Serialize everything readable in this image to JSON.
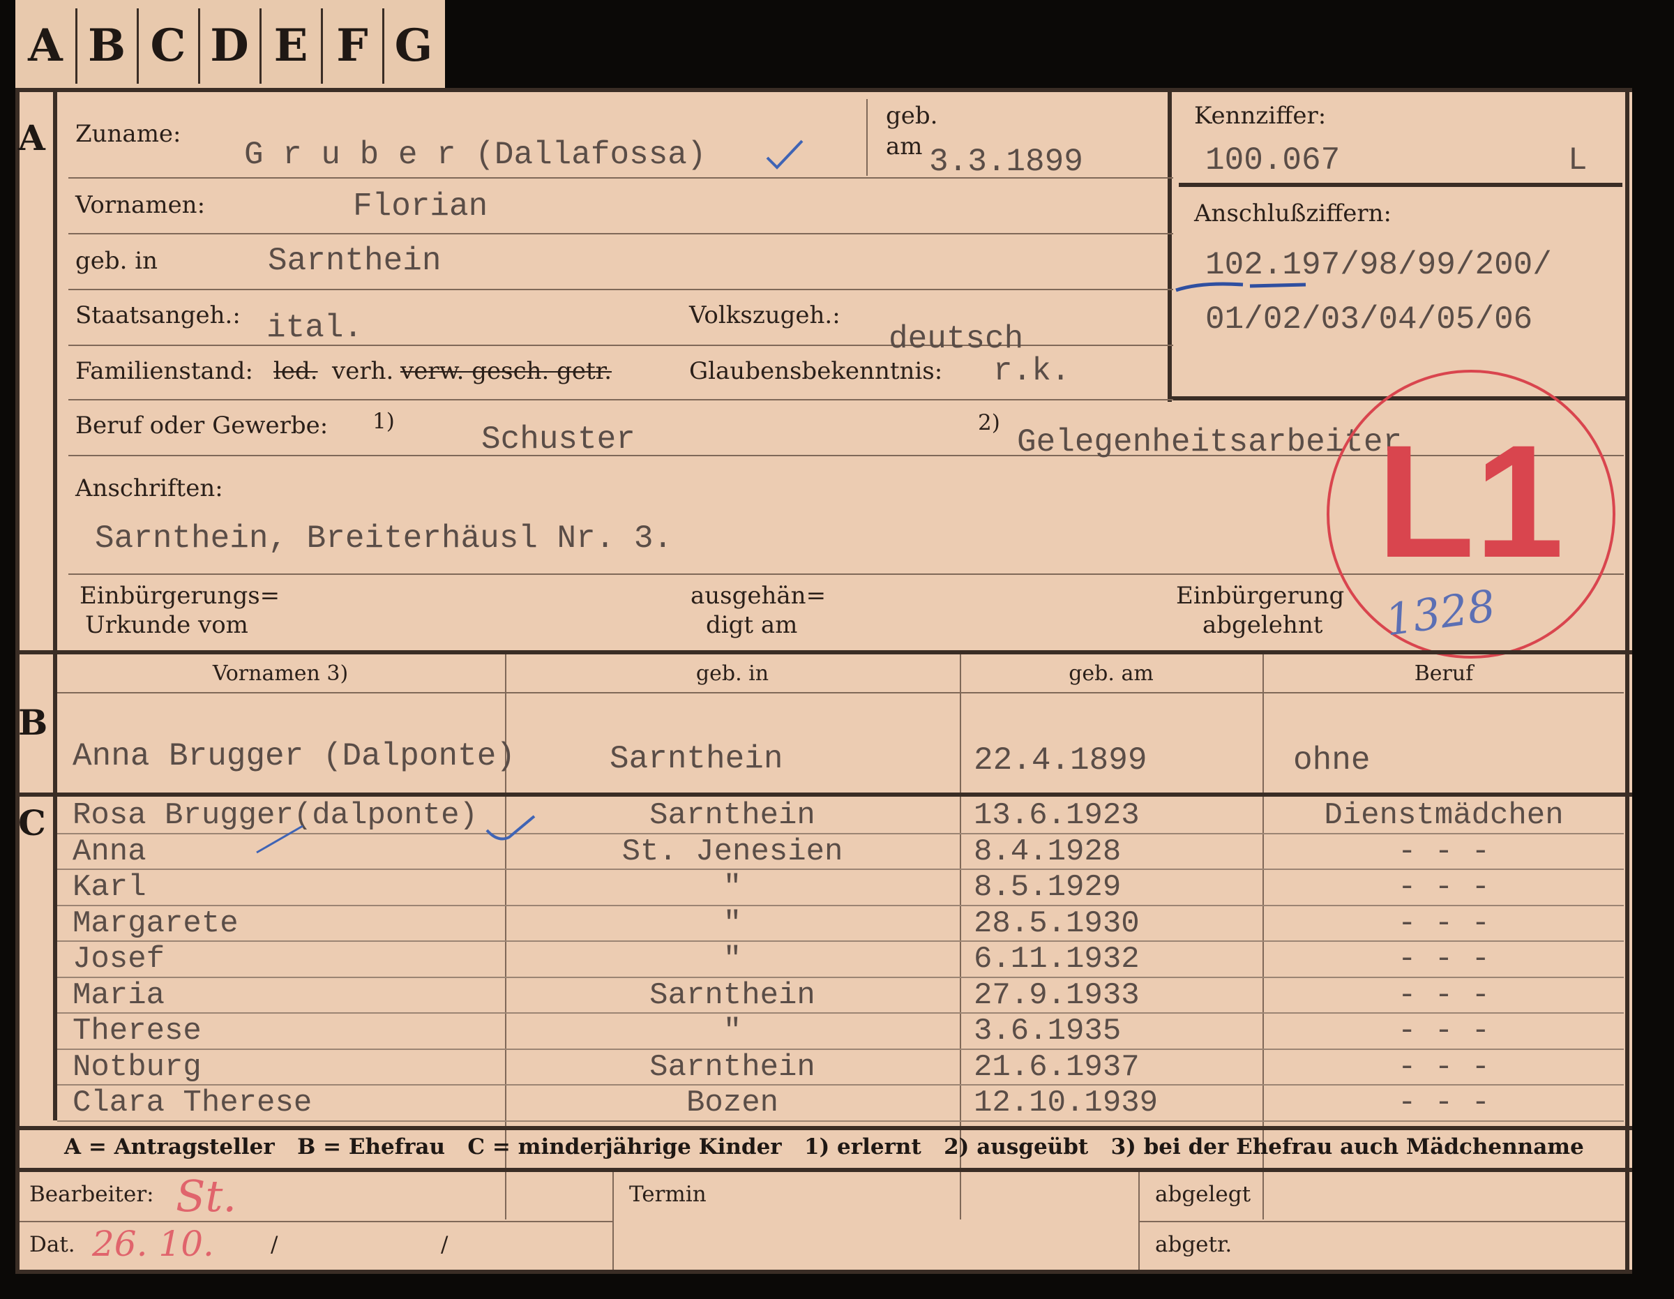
{
  "tabs": [
    "A",
    "B",
    "C",
    "D",
    "E",
    "F",
    "G"
  ],
  "section_a": {
    "marker": "A",
    "zuname_label": "Zuname:",
    "zuname_value": "G r u b e r (Dallafossa)",
    "geb_label": "geb.",
    "am_label": "am",
    "geb_am_value": "3.3.1899",
    "kennziffer_label": "Kennziffer:",
    "kennziffer_value": "100.067",
    "kennziffer_suffix": "L",
    "vornamen_label": "Vornamen:",
    "vornamen_value": "Florian",
    "geb_in_label": "geb. in",
    "geb_in_value": "Sarnthein",
    "anschluss_label": "Anschlußziffern:",
    "anschluss_line1": "102.197/98/99/200/",
    "anschluss_line2": "01/02/03/04/05/06",
    "staatsangeh_label": "Staatsangeh.:",
    "staatsangeh_value": "ital.",
    "volkszugeh_label": "Volkszugeh.:",
    "volkszugeh_value": "deutsch",
    "familienstand_label": "Familienstand:",
    "familienstand_struck1": "led.",
    "familienstand_value": "verh.",
    "familienstand_struck2": "verw. gesch. getr.",
    "glauben_label": "Glaubensbekenntnis:",
    "glauben_value": "r.k.",
    "beruf_label": "Beruf oder Gewerbe:",
    "beruf_note1": "1)",
    "beruf_value1": "Schuster",
    "beruf_note2": "2)",
    "beruf_value2": "Gelegenheitsarbeiter",
    "anschriften_label": "Anschriften:",
    "anschriften_value": "Sarnthein, Breiterhäusl Nr. 3.",
    "einb_label_1": "Einbürgerungs=",
    "einb_label_2": "Urkunde vom",
    "ausgeh_label_1": "ausgehän=",
    "ausgeh_label_2": "digt am",
    "abgelehnt_label_1": "Einbürgerung",
    "abgelehnt_label_2": "abgelehnt"
  },
  "stamp": {
    "code": "L1",
    "number": "1328",
    "color": "#d9454e"
  },
  "section_b": {
    "marker": "B",
    "headers": [
      "Vornamen 3)",
      "geb. in",
      "geb. am",
      "Beruf"
    ],
    "row": {
      "name": "Anna Brugger (Dalponte)",
      "place": "Sarnthein",
      "date": "22.4.1899",
      "job": "ohne"
    }
  },
  "section_c": {
    "marker": "C",
    "children": [
      {
        "name": "Rosa Brugger(dalponte)",
        "place": "Sarnthein",
        "date": "13.6.1923",
        "job": "Dienstmädchen"
      },
      {
        "name": "Anna",
        "place": "St. Jenesien",
        "date": "8.4.1928",
        "job": "- - -"
      },
      {
        "name": "Karl",
        "place": "\"",
        "date": "8.5.1929",
        "job": "- - -"
      },
      {
        "name": "Margarete",
        "place": "\"",
        "date": "28.5.1930",
        "job": "- - -"
      },
      {
        "name": "Josef",
        "place": "\"",
        "date": "6.11.1932",
        "job": "- - -"
      },
      {
        "name": "Maria",
        "place": "Sarnthein",
        "date": "27.9.1933",
        "job": "- - -"
      },
      {
        "name": "Therese",
        "place": "\"",
        "date": "3.6.1935",
        "job": "- - -"
      },
      {
        "name": "Notburg",
        "place": "Sarnthein",
        "date": "21.6.1937",
        "job": "- - -"
      },
      {
        "name": "Clara Therese",
        "place": "Bozen",
        "date": "12.10.1939",
        "job": "- - -"
      }
    ]
  },
  "legend": "A = Antragsteller   B = Ehefrau   C = minderjährige Kinder   1) erlernt   2) ausgeübt   3) bei der Ehefrau auch Mädchenname",
  "footer": {
    "bearbeiter_label": "Bearbeiter:",
    "bearbeiter_sig": "St.",
    "dat_label": "Dat.",
    "dat_value": "26. 10.",
    "dat_slash1": "/",
    "dat_slash2": "/",
    "termin_label": "Termin",
    "abgelegt_label": "abgelegt",
    "abgetr_label": "abgetr."
  },
  "colors": {
    "card": "#ecccb2",
    "ink_blue": "#3f64b5",
    "ink_red": "#e0646c",
    "stamp_red": "#d9454e"
  }
}
